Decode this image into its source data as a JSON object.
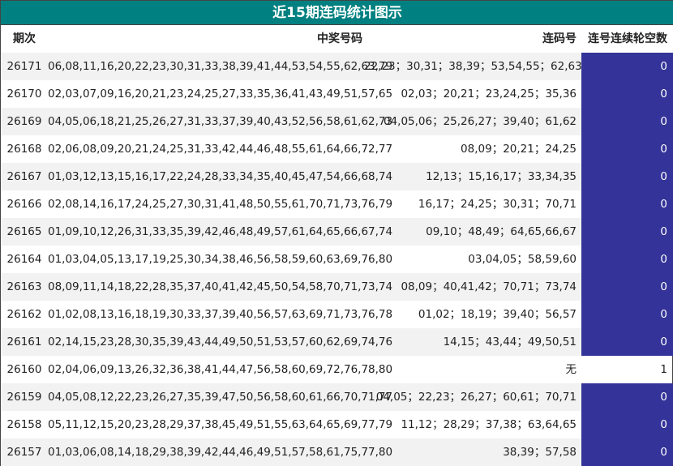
{
  "title": "近15期连码统计图示",
  "headers": {
    "period": "期次",
    "numbers": "中奖号码",
    "consecutive": "连码号",
    "miss": "连号连续轮空数"
  },
  "colors": {
    "title_bg": "#008080",
    "miss_bar": "#333399",
    "alt_row": "#f2f2f2"
  },
  "chart_data": {
    "type": "table",
    "title": "近15期连码统计图示",
    "columns": [
      "期次",
      "中奖号码",
      "连码号",
      "连号连续轮空数"
    ],
    "rows": [
      {
        "period": "26171",
        "numbers": "06,08,11,16,20,22,23,30,31,33,38,39,41,44,53,54,55,62,63,79",
        "consecutive": "22,23；30,31；38,39；53,54,55；62,63",
        "miss": 0
      },
      {
        "period": "26170",
        "numbers": "02,03,07,09,16,20,21,23,24,25,27,33,35,36,41,43,49,51,57,65",
        "consecutive": "02,03；20,21；23,24,25；35,36",
        "miss": 0
      },
      {
        "period": "26169",
        "numbers": "04,05,06,18,21,25,26,27,31,33,37,39,40,43,52,56,58,61,62,73",
        "consecutive": "04,05,06；25,26,27；39,40；61,62",
        "miss": 0
      },
      {
        "period": "26168",
        "numbers": "02,06,08,09,20,21,24,25,31,33,42,44,46,48,55,61,64,66,72,77",
        "consecutive": "08,09；20,21；24,25",
        "miss": 0
      },
      {
        "period": "26167",
        "numbers": "01,03,12,13,15,16,17,22,24,28,33,34,35,40,45,47,54,66,68,74",
        "consecutive": "12,13；15,16,17；33,34,35",
        "miss": 0
      },
      {
        "period": "26166",
        "numbers": "02,08,14,16,17,24,25,27,30,31,41,48,50,55,61,70,71,73,76,79",
        "consecutive": "16,17；24,25；30,31；70,71",
        "miss": 0
      },
      {
        "period": "26165",
        "numbers": "01,09,10,12,26,31,33,35,39,42,46,48,49,57,61,64,65,66,67,74",
        "consecutive": "09,10；48,49；64,65,66,67",
        "miss": 0
      },
      {
        "period": "26164",
        "numbers": "01,03,04,05,13,17,19,25,30,34,38,46,56,58,59,60,63,69,76,80",
        "consecutive": "03,04,05；58,59,60",
        "miss": 0
      },
      {
        "period": "26163",
        "numbers": "08,09,11,14,18,22,28,35,37,40,41,42,45,50,54,58,70,71,73,74",
        "consecutive": "08,09；40,41,42；70,71；73,74",
        "miss": 0
      },
      {
        "period": "26162",
        "numbers": "01,02,08,13,16,18,19,30,33,37,39,40,56,57,63,69,71,73,76,78",
        "consecutive": "01,02；18,19；39,40；56,57",
        "miss": 0
      },
      {
        "period": "26161",
        "numbers": "02,14,15,23,28,30,35,39,43,44,49,50,51,53,57,60,62,69,74,76",
        "consecutive": "14,15；43,44；49,50,51",
        "miss": 0
      },
      {
        "period": "26160",
        "numbers": "02,04,06,09,13,26,32,36,38,41,44,47,56,58,60,69,72,76,78,80",
        "consecutive": "无",
        "miss": 1
      },
      {
        "period": "26159",
        "numbers": "04,05,08,12,22,23,26,27,35,39,47,50,56,58,60,61,66,70,71,77",
        "consecutive": "04,05；22,23；26,27；60,61；70,71",
        "miss": 0
      },
      {
        "period": "26158",
        "numbers": "05,11,12,15,20,23,28,29,37,38,45,49,51,55,63,64,65,69,77,79",
        "consecutive": "11,12；28,29；37,38；63,64,65",
        "miss": 0
      },
      {
        "period": "26157",
        "numbers": "01,03,06,08,14,18,29,38,39,42,44,46,49,51,57,58,61,75,77,80",
        "consecutive": "38,39；57,58",
        "miss": 0
      }
    ]
  }
}
